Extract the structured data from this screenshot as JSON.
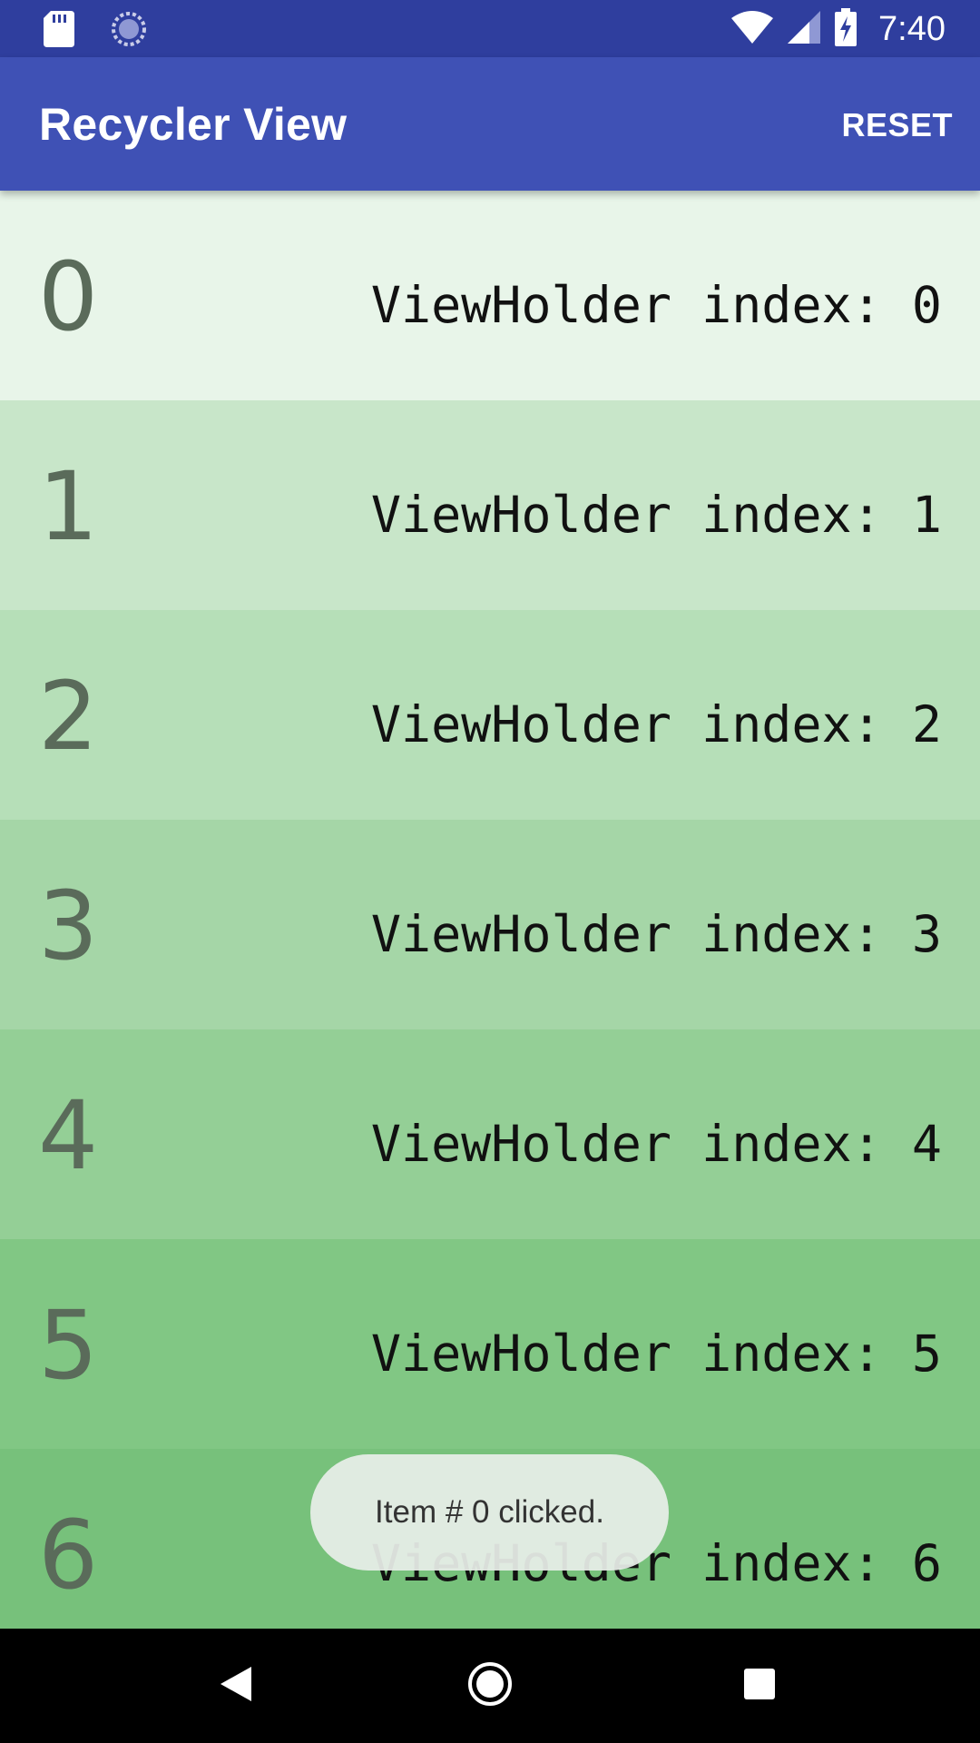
{
  "status_bar": {
    "time": "7:40",
    "icons": [
      "sd-card-icon",
      "sync-icon",
      "wifi-icon",
      "signal-icon",
      "battery-charging-icon"
    ]
  },
  "app_bar": {
    "title": "Recycler View",
    "reset_label": "RESET"
  },
  "list": {
    "items": [
      {
        "number": "0",
        "label": "ViewHolder index: 0",
        "bg": "#e8f5e9"
      },
      {
        "number": "1",
        "label": "ViewHolder index: 1",
        "bg": "#c8e6c9"
      },
      {
        "number": "2",
        "label": "ViewHolder index: 2",
        "bg": "#b6dfb8"
      },
      {
        "number": "3",
        "label": "ViewHolder index: 3",
        "bg": "#a5d6a7"
      },
      {
        "number": "4",
        "label": "ViewHolder index: 4",
        "bg": "#94cf96"
      },
      {
        "number": "5",
        "label": "ViewHolder index: 5",
        "bg": "#81c784"
      },
      {
        "number": "6",
        "label": "ViewHolder index: 6",
        "bg": "#77c17b"
      }
    ]
  },
  "toast": {
    "message": "Item # 0 clicked."
  },
  "colors": {
    "status_bar": "#2f3e9e",
    "app_bar": "#3f51b5",
    "nav_bar": "#000000"
  },
  "nav_bar": {
    "icons": [
      "back-icon",
      "home-icon",
      "recents-icon"
    ]
  }
}
